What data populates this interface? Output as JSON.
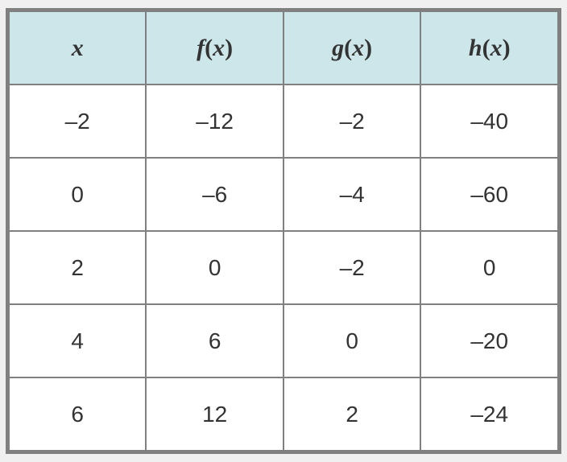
{
  "chart_data": {
    "type": "table",
    "headers": [
      "x",
      "f(x)",
      "g(x)",
      "h(x)"
    ],
    "rows": [
      {
        "x": "–2",
        "f": "–12",
        "g": "–2",
        "h": "–40"
      },
      {
        "x": "0",
        "f": "–6",
        "g": "–4",
        "h": "–60"
      },
      {
        "x": "2",
        "f": "0",
        "g": "–2",
        "h": "0"
      },
      {
        "x": "4",
        "f": "6",
        "g": "0",
        "h": "–20"
      },
      {
        "x": "6",
        "f": "12",
        "g": "2",
        "h": "–24"
      }
    ]
  }
}
